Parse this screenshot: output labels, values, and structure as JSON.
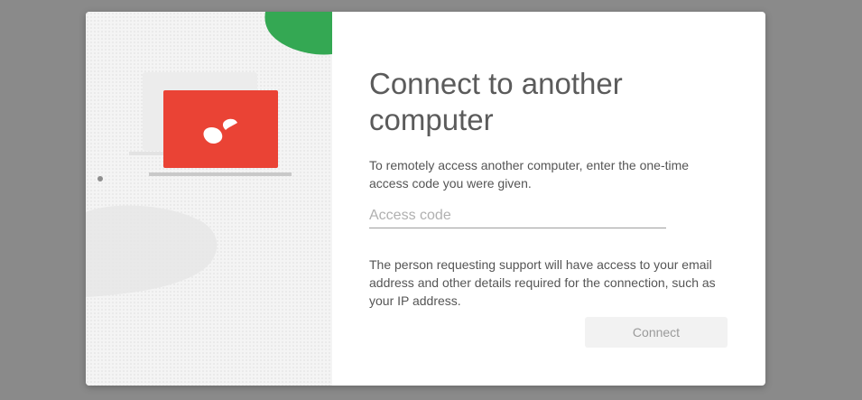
{
  "dialog": {
    "title": "Connect to another computer",
    "instructions": "To remotely access another computer, enter the one-time access code you were given.",
    "access_code": {
      "value": "",
      "placeholder": "Access code"
    },
    "notice": "The person requesting support will have access to your email address and other details required for the connection, such as your IP address.",
    "connect_label": "Connect",
    "connect_enabled": false
  },
  "illustration": {
    "icons": [
      "laptop-icon",
      "remote-desktop-logo-icon"
    ],
    "colors": {
      "laptop_screen": "#ea4335",
      "green_blob": "#34a853",
      "background": "#f4f4f4"
    }
  },
  "colors": {
    "title_text": "#5b5b5b",
    "body_text": "#555555",
    "button_bg": "#f2f2f2",
    "button_text": "#9a9a9a"
  }
}
